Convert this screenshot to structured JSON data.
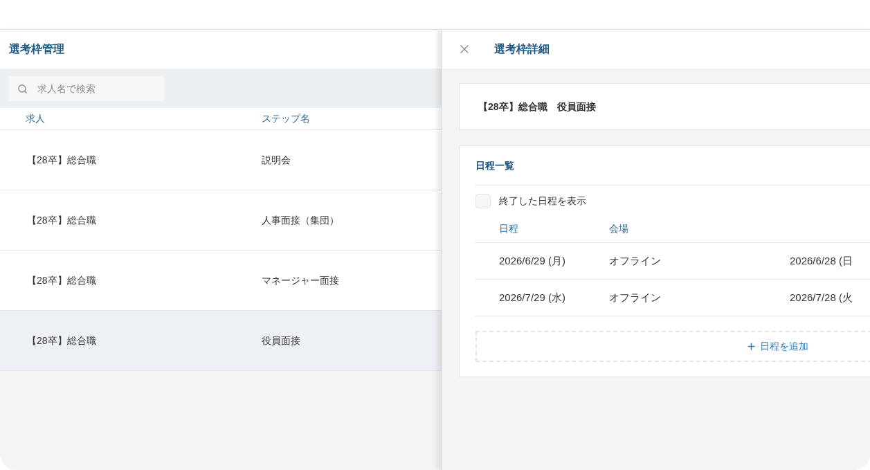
{
  "list_panel": {
    "title": "選考枠管理",
    "search": {
      "placeholder": "求人名で検索"
    },
    "table": {
      "columns": [
        "求人",
        "ステップ名"
      ],
      "rows": [
        {
          "job": "【28卒】総合職",
          "step": "説明会",
          "selected": false
        },
        {
          "job": "【28卒】総合職",
          "step": "人事面接（集団）",
          "selected": false
        },
        {
          "job": "【28卒】総合職",
          "step": "マネージャー面接",
          "selected": false
        },
        {
          "job": "【28卒】総合職",
          "step": "役員面接",
          "selected": true
        }
      ]
    }
  },
  "detail_panel": {
    "title": "選考枠詳細",
    "summary": "【28卒】総合職　役員面接",
    "schedule": {
      "title": "日程一覧",
      "show_finished": {
        "label": "終了した日程を表示",
        "checked": false
      },
      "columns": [
        "日程",
        "会場"
      ],
      "rows": [
        {
          "date": "2026/6/29 (月)",
          "venue": "オフライン",
          "column_3": "2026/6/28 (日"
        },
        {
          "date": "2026/7/29 (水)",
          "venue": "オフライン",
          "column_3": "2026/7/28 (火"
        }
      ],
      "add_button": "日程を追加"
    }
  }
}
